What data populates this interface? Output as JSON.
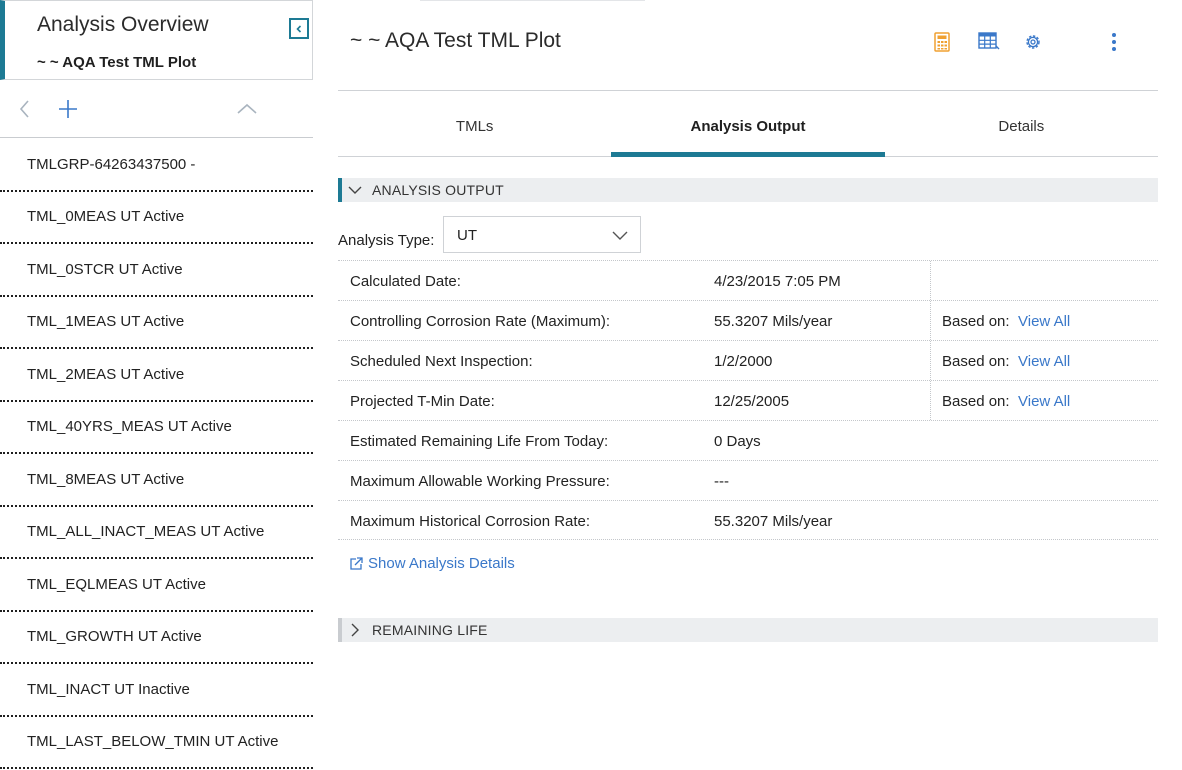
{
  "sidebar": {
    "title": "Analysis Overview",
    "subtitle": "~ ~ AQA Test TML Plot",
    "items": [
      "TMLGRP-64263437500 -",
      "TML_0MEAS UT Active",
      "TML_0STCR UT Active",
      "TML_1MEAS UT Active",
      "TML_2MEAS UT Active",
      "TML_40YRS_MEAS UT Active",
      "TML_8MEAS UT Active",
      "TML_ALL_INACT_MEAS UT Active",
      "TML_EQLMEAS UT Active",
      "TML_GROWTH UT Active",
      "TML_INACT UT Inactive",
      "TML_LAST_BELOW_TMIN UT Active"
    ]
  },
  "header": {
    "title": "~ ~ AQA Test TML Plot"
  },
  "tabs": [
    {
      "label": "TMLs",
      "active": false
    },
    {
      "label": "Analysis Output",
      "active": true
    },
    {
      "label": "Details",
      "active": false
    }
  ],
  "analysis_output": {
    "section_label": "ANALYSIS OUTPUT",
    "analysis_type_label": "Analysis Type:",
    "analysis_type_value": "UT",
    "rows": [
      {
        "label": "Calculated Date:",
        "value": "4/23/2015 7:05 PM",
        "based_on": "",
        "link": ""
      },
      {
        "label": "Controlling Corrosion Rate (Maximum):",
        "value": "55.3207 Mils/year",
        "based_on": "Based on:",
        "link": "View All"
      },
      {
        "label": "Scheduled Next Inspection:",
        "value": "1/2/2000",
        "based_on": "Based on:",
        "link": "View All"
      },
      {
        "label": "Projected T-Min Date:",
        "value": "12/25/2005",
        "based_on": "Based on:",
        "link": "View All"
      },
      {
        "label": "Estimated Remaining Life From Today:",
        "value": "0 Days",
        "based_on": "",
        "link": ""
      },
      {
        "label": "Maximum Allowable Working Pressure:",
        "value": "---",
        "based_on": "",
        "link": ""
      },
      {
        "label": "Maximum Historical Corrosion Rate:",
        "value": "55.3207 Mils/year",
        "based_on": "",
        "link": ""
      }
    ],
    "show_details_label": "Show Analysis Details"
  },
  "remaining_life": {
    "section_label": "REMAINING LIFE"
  },
  "colors": {
    "accent": "#1d7a94",
    "link": "#3a78c9",
    "calculator_icon": "#f0a030",
    "toolbar_icon": "#3a78c9",
    "section_bg": "#eceef0"
  },
  "icons": {
    "collapse": "collapse-left-icon",
    "back": "chevron-left-icon",
    "add": "plus-icon",
    "up": "chevron-up-icon",
    "calculator": "calculator-icon",
    "table": "table-icon",
    "settings": "gear-icon",
    "more": "more-vertical-icon",
    "external": "external-link-icon"
  }
}
